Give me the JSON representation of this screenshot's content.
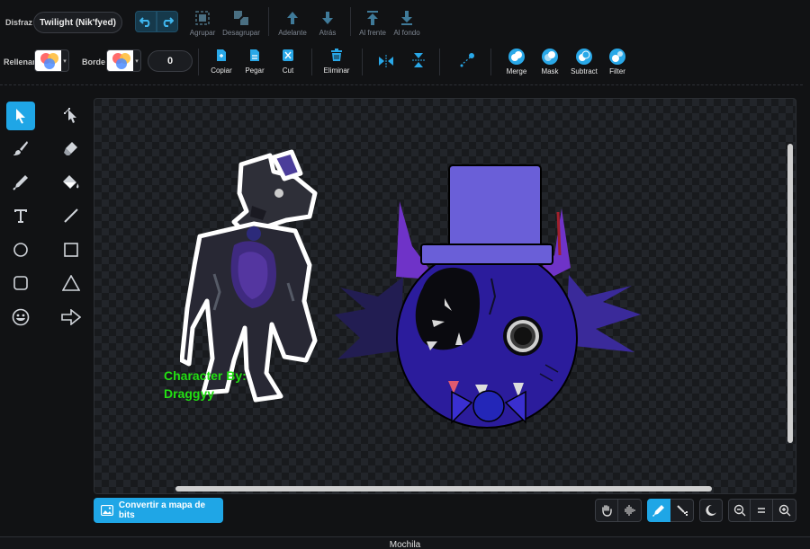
{
  "costume": {
    "label": "Disfraz",
    "name": "Twilight (Nik'fyed)"
  },
  "toolbar_top": {
    "group": "Agrupar",
    "ungroup": "Desagrupar",
    "forward": "Adelante",
    "backward": "Atrás",
    "front": "Al frente",
    "back": "Al fondo"
  },
  "toolbar_second": {
    "fill_label": "Rellenar",
    "outline_label": "Borde",
    "outline_width": "0",
    "copy": "Copiar",
    "paste": "Pegar",
    "cut": "Cut",
    "delete": "Eliminar",
    "merge": "Merge",
    "mask": "Mask",
    "subtract": "Subtract",
    "filter": "Filter"
  },
  "canvas": {
    "credit_line1": "Character By:",
    "credit_line2": "Draggyy"
  },
  "bottom": {
    "convert_button": "Convertir a mapa de bits",
    "backpack": "Mochila"
  },
  "colors": {
    "accent": "#1fa6e6",
    "background": "#111214",
    "credit_text": "#22e012"
  }
}
